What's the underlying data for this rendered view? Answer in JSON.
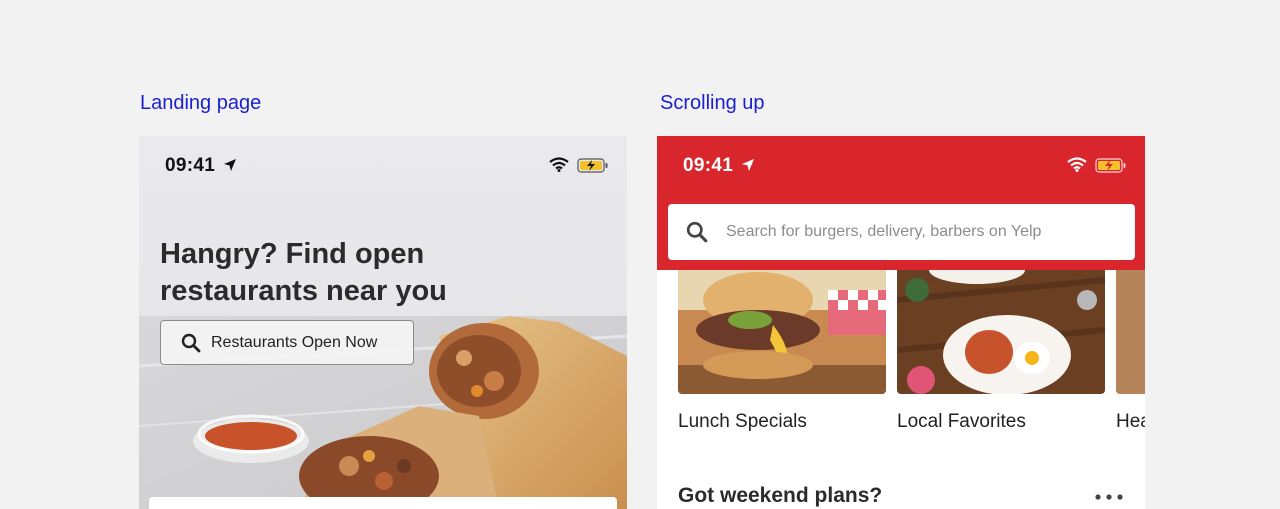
{
  "captions": {
    "left": "Landing page",
    "right": "Scrolling up"
  },
  "landing": {
    "status_time": "09:41",
    "hero_title": "Hangry? Find open restaurants near you",
    "cta_label": "Restaurants Open Now"
  },
  "scrolled": {
    "status_time": "09:41",
    "search_placeholder": "Search for burgers, delivery, barbers on Yelp",
    "categories": [
      {
        "label": "Lunch Specials"
      },
      {
        "label": "Local Favorites"
      },
      {
        "label": "Hea"
      }
    ],
    "section_title": "Got weekend plans?"
  },
  "colors": {
    "caption": "#1a1fd0",
    "brand_red": "#d9262c",
    "battery_fill": "#f2c12e"
  },
  "icons": [
    "location-arrow-icon",
    "wifi-icon",
    "battery-charging-icon",
    "search-icon",
    "more-dots-icon"
  ]
}
